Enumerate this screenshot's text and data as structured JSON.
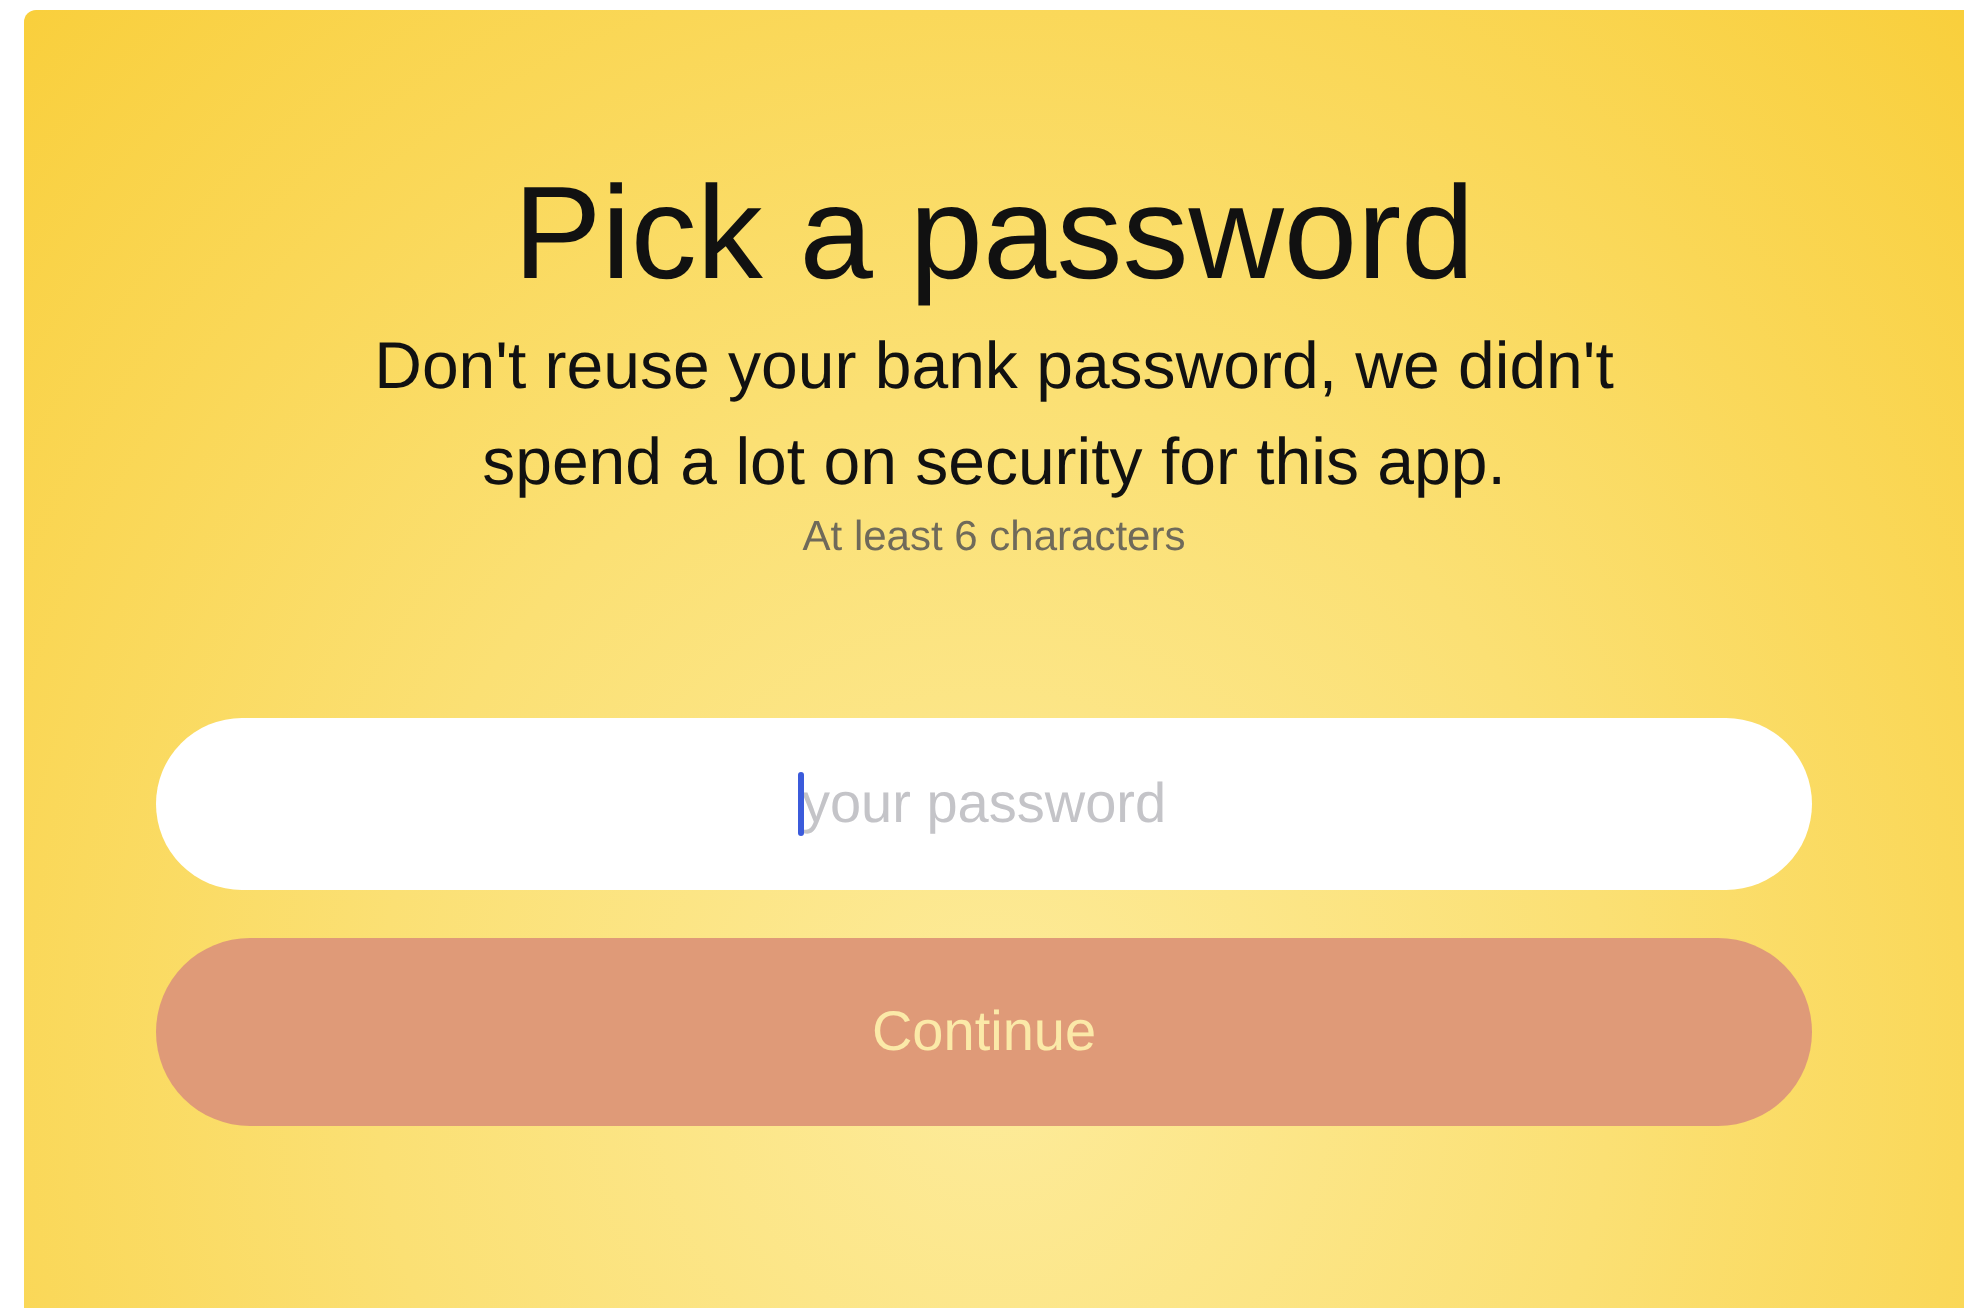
{
  "title": "Pick a password",
  "subtitle": "Don't reuse your bank password, we didn't spend a lot on security for this app.",
  "hint": "At least 6 characters",
  "password_field": {
    "placeholder": "your password",
    "focused": true
  },
  "continue_button": {
    "label": "Continue",
    "disabled": true
  }
}
